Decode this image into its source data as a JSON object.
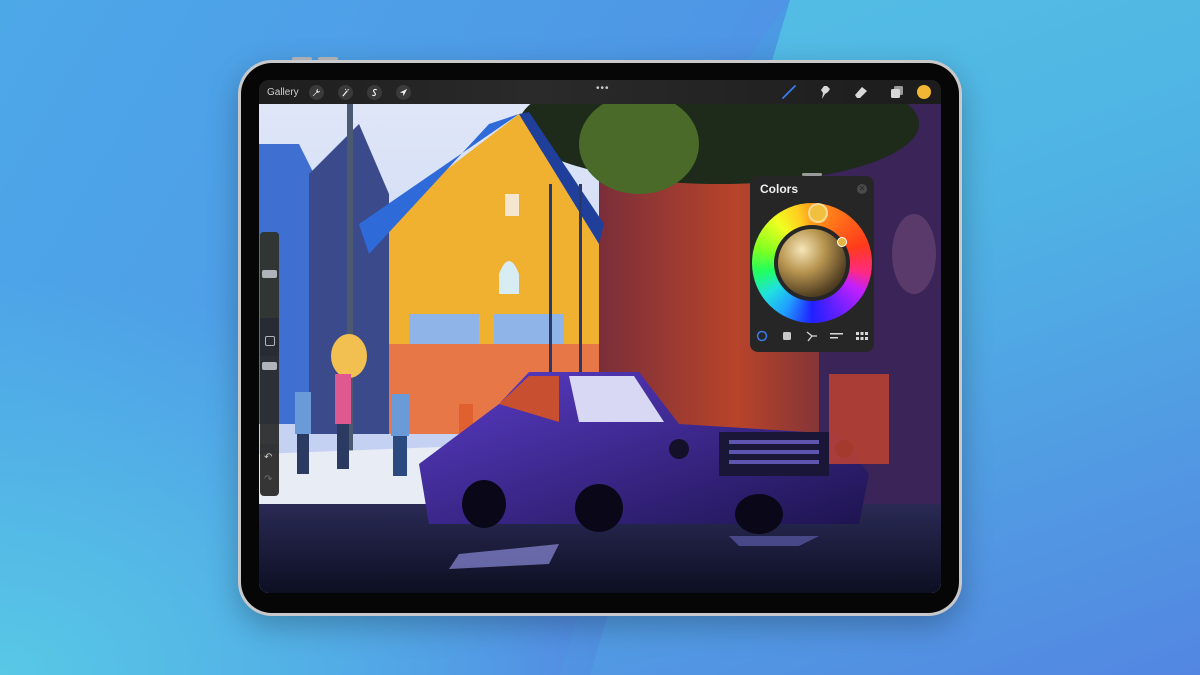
{
  "app": "Procreate",
  "toolbar": {
    "gallery_label": "Gallery",
    "left_tools": [
      {
        "name": "actions",
        "icon": "wrench-icon"
      },
      {
        "name": "adjustments",
        "icon": "magic-wand-icon"
      },
      {
        "name": "selection",
        "icon": "selection-s-icon"
      },
      {
        "name": "transform",
        "icon": "arrow-cursor-icon"
      }
    ],
    "more_label": "•••",
    "right_tools": [
      {
        "name": "brush",
        "icon": "brush-icon",
        "active": true
      },
      {
        "name": "smudge",
        "icon": "smudge-icon"
      },
      {
        "name": "eraser",
        "icon": "eraser-icon"
      },
      {
        "name": "layers",
        "icon": "layers-icon"
      }
    ],
    "current_color": "#f2b632",
    "active_tool_color": "#3a7bf0"
  },
  "sidebar": {
    "brush_size": 0.55,
    "opacity": 0.45,
    "modify_button": "square-icon",
    "undo_icon": "undo-icon",
    "redo_icon": "redo-icon"
  },
  "colors_panel": {
    "title": "Colors",
    "close_icon": "close-icon",
    "selected_color": "#f2b632",
    "tabs": [
      {
        "name": "disc",
        "icon": "circle-icon",
        "active": true
      },
      {
        "name": "classic",
        "icon": "square-icon"
      },
      {
        "name": "harmony",
        "icon": "harmony-icon"
      },
      {
        "name": "value",
        "icon": "sliders-icon"
      },
      {
        "name": "palettes",
        "icon": "grid-icon"
      }
    ]
  },
  "canvas": {
    "description": "Digital painting of a sunlit street with a yellow house and a purple vintage car"
  }
}
